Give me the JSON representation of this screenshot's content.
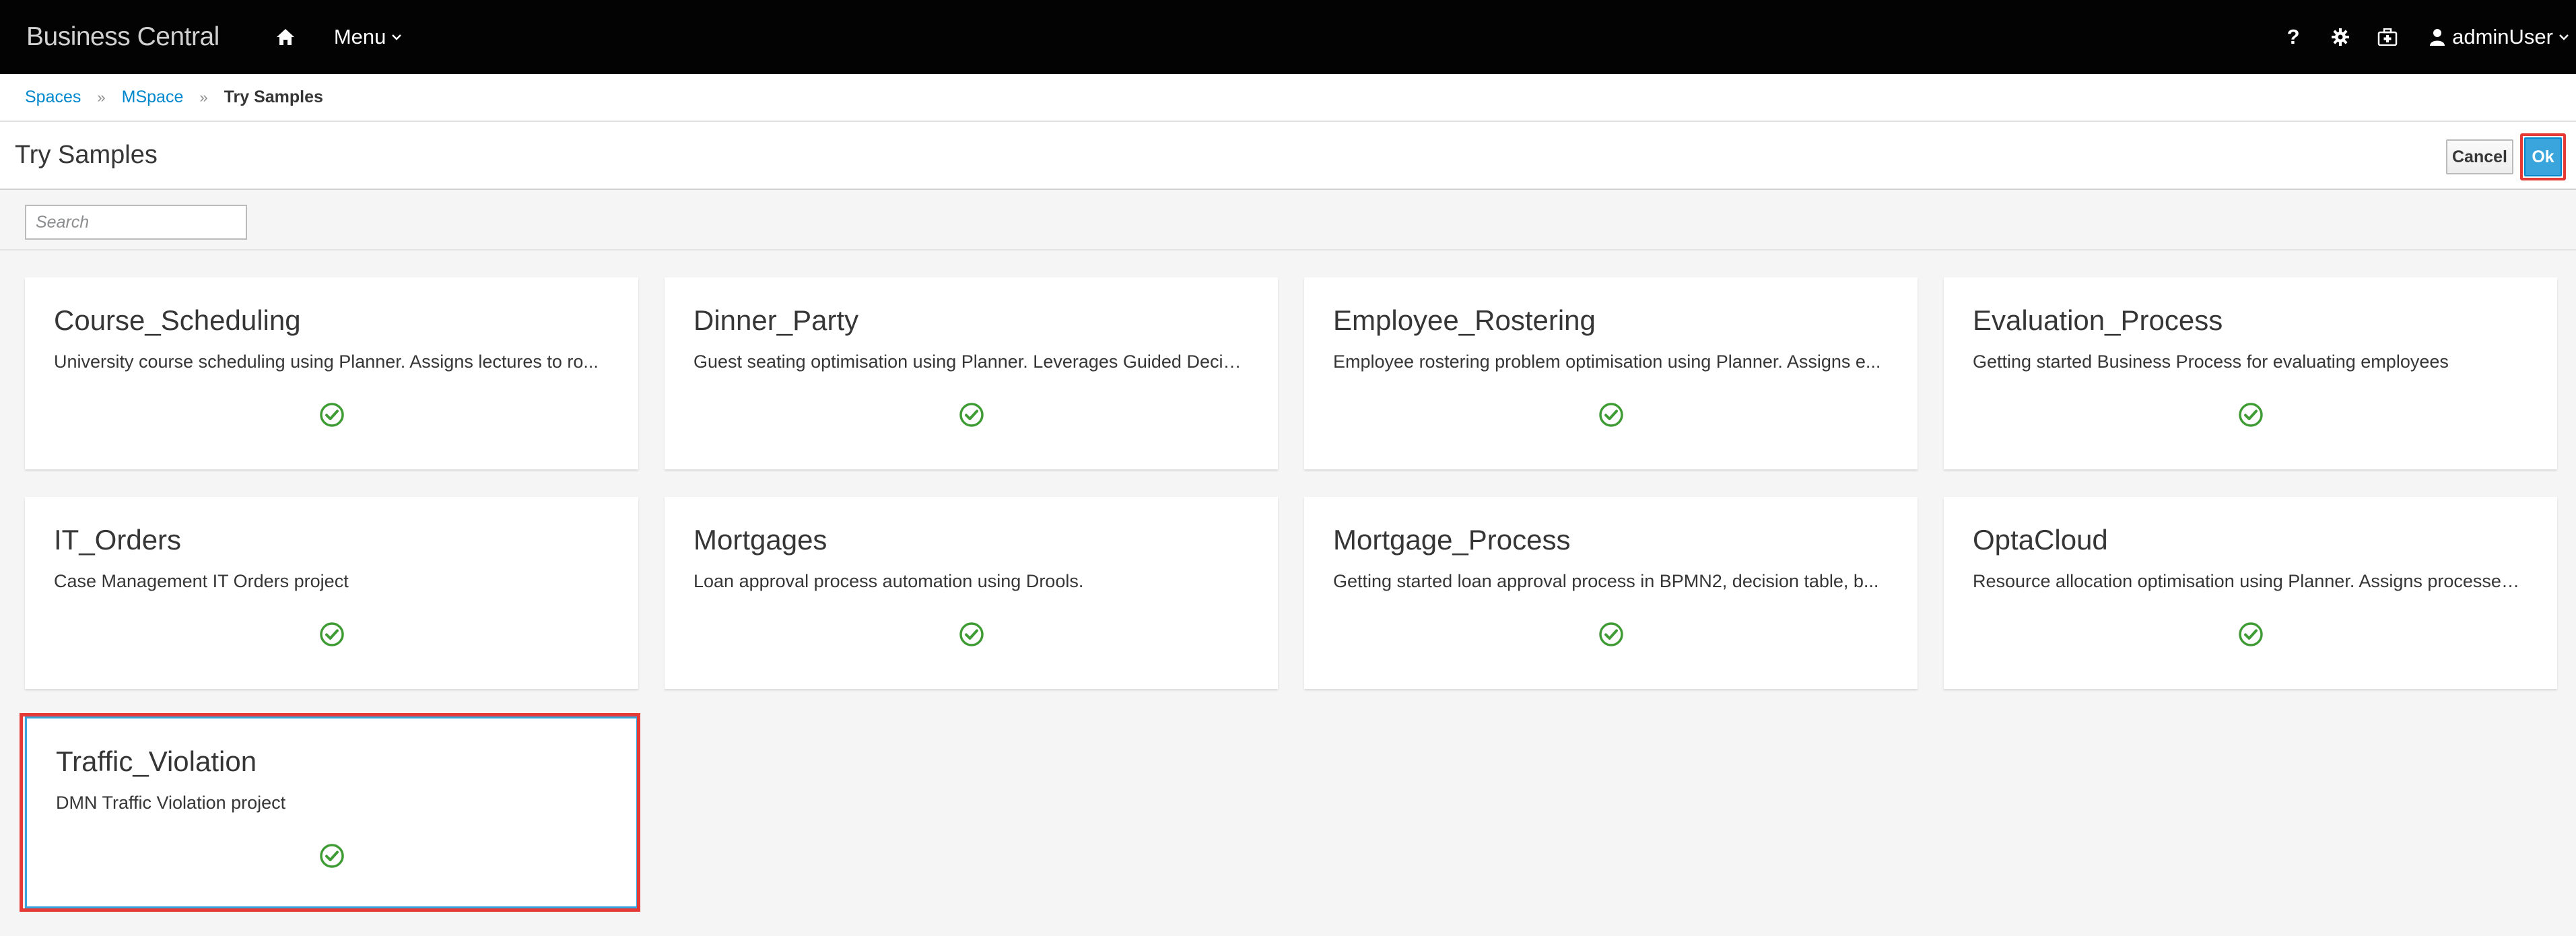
{
  "navbar": {
    "brand": "Business Central",
    "menu_label": "Menu",
    "help_label": "?",
    "user_label": "adminUser"
  },
  "breadcrumb": {
    "items": [
      "Spaces",
      "MSpace"
    ],
    "current": "Try Samples"
  },
  "page": {
    "title": "Try Samples",
    "cancel_label": "Cancel",
    "ok_label": "Ok"
  },
  "search": {
    "placeholder": "Search",
    "value": ""
  },
  "cards": [
    {
      "title": "Course_Scheduling",
      "description": "University course scheduling using Planner. Assigns lectures to ro...",
      "checked": true
    },
    {
      "title": "Dinner_Party",
      "description": "Guest seating optimisation using Planner. Leverages Guided Decis...",
      "checked": true
    },
    {
      "title": "Employee_Rostering",
      "description": "Employee rostering problem optimisation using Planner. Assigns e...",
      "checked": true
    },
    {
      "title": "Evaluation_Process",
      "description": "Getting started Business Process for evaluating employees",
      "checked": true
    },
    {
      "title": "IT_Orders",
      "description": "Case Management IT Orders project",
      "checked": true
    },
    {
      "title": "Mortgages",
      "description": "Loan approval process automation using Drools.",
      "checked": true
    },
    {
      "title": "Mortgage_Process",
      "description": "Getting started loan approval process in BPMN2, decision table, b...",
      "checked": true
    },
    {
      "title": "OptaCloud",
      "description": "Resource allocation optimisation using Planner. Assigns processes...",
      "checked": true
    },
    {
      "title": "Traffic_Violation",
      "description": "DMN Traffic Violation project",
      "checked": true,
      "selected": true
    }
  ],
  "colors": {
    "navbar_bg": "#030303",
    "link": "#0088ce",
    "primary_button": "#39a5dc",
    "check_green": "#3f9c35",
    "highlight_red": "#e53935"
  },
  "icons": {
    "home": "home-icon",
    "menu_caret": "chevron-down-icon",
    "help": "help-icon",
    "settings": "gear-icon",
    "support": "first-aid-kit-icon",
    "user": "user-icon",
    "card_status": "check-circle-icon"
  }
}
